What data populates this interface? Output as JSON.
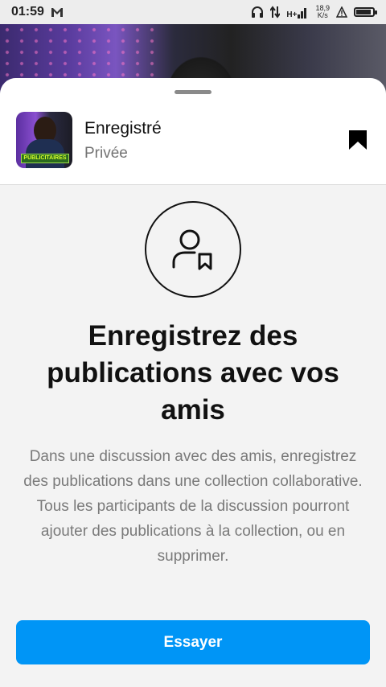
{
  "status_bar": {
    "time": "01:59",
    "network_type": "H+",
    "speed_value": "18,9",
    "speed_unit": "K/s"
  },
  "collection": {
    "title": "Enregistré",
    "visibility": "Privée",
    "thumbnail_banner": "PUBLICITAIRES"
  },
  "main": {
    "headline": "Enregistrez des publications avec vos amis",
    "description": "Dans une discussion avec des amis, enregistrez des publications dans une collection collaborative. Tous les participants de la discussion pourront ajouter des publications à la collection, ou en supprimer.",
    "cta_label": "Essayer"
  },
  "colors": {
    "accent": "#0095f6",
    "sheet_background": "#f3f3f3",
    "text_primary": "#111111",
    "text_secondary": "#7a7a7a"
  },
  "icons": {
    "status": [
      "gmail-icon",
      "headphones-icon",
      "data-arrows-icon",
      "signal-icon",
      "alert-icon",
      "battery-icon"
    ],
    "collection": "bookmark-filled-icon",
    "feature": "person-bookmark-icon"
  }
}
